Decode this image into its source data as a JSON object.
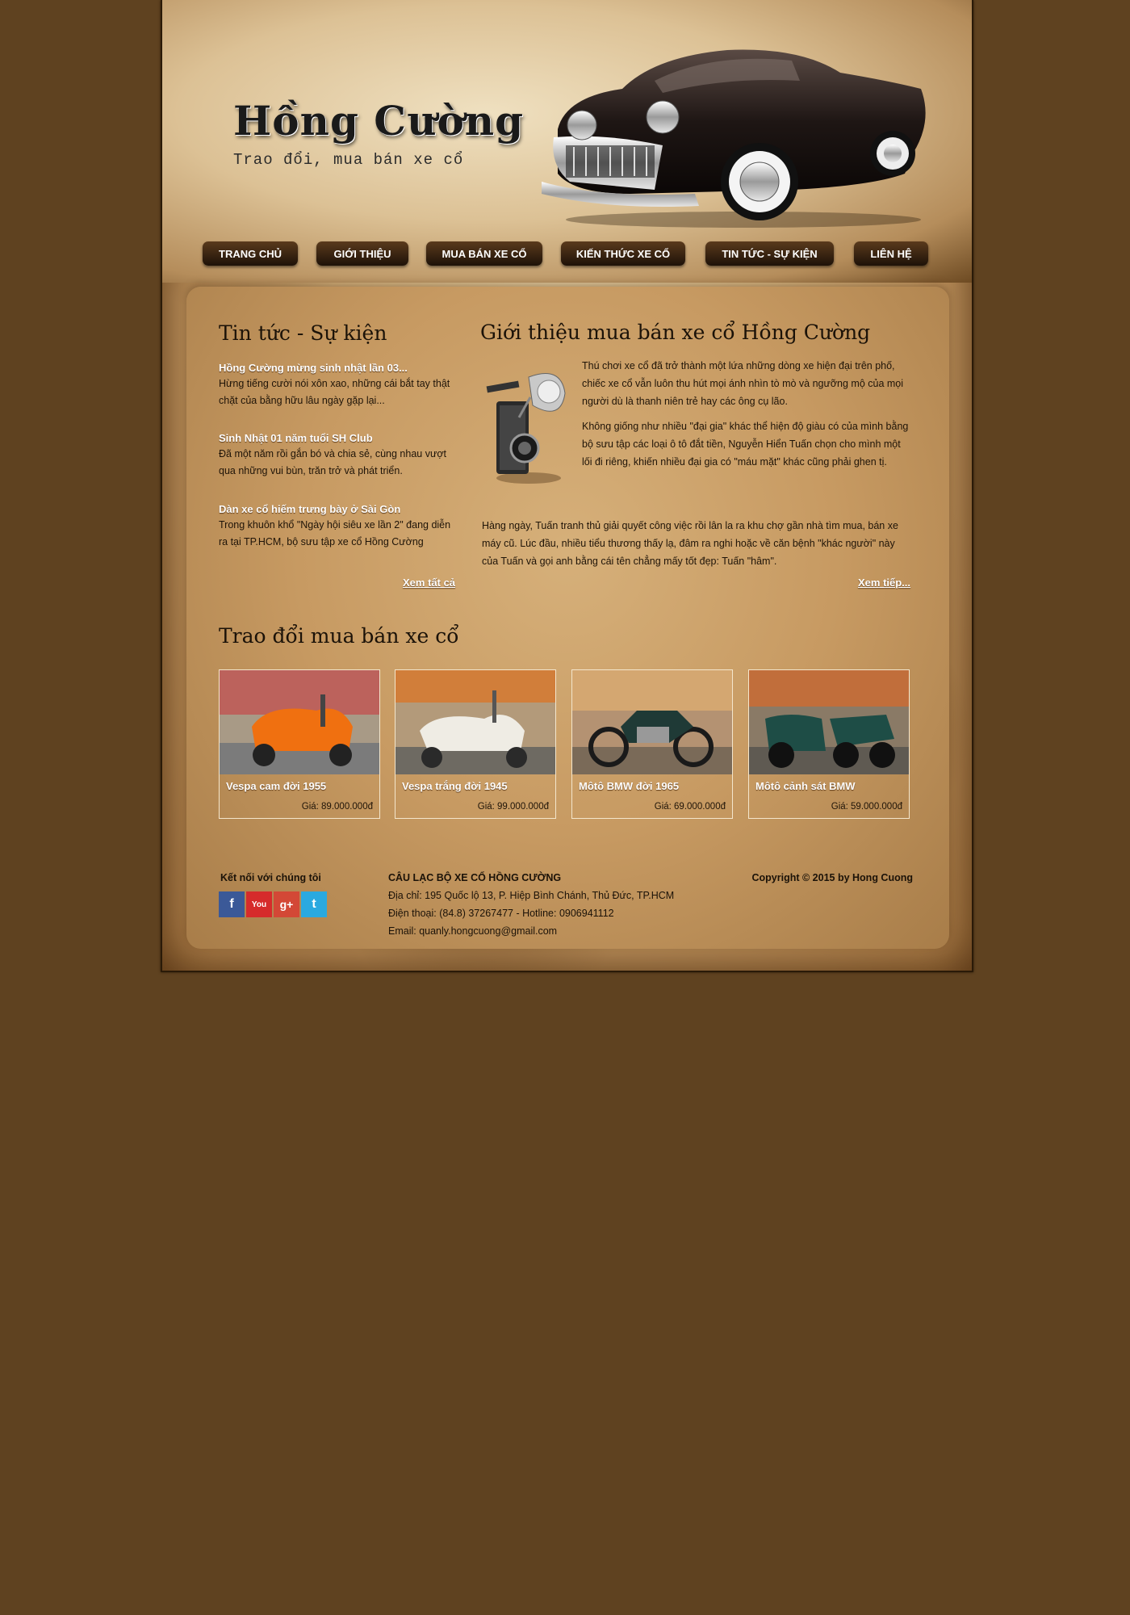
{
  "header": {
    "logo_title": "Hồng Cường",
    "logo_subtitle": "Trao đổi, mua bán xe cổ"
  },
  "nav": [
    {
      "label": "TRANG CHỦ"
    },
    {
      "label": "GIỚI THIỆU"
    },
    {
      "label": "MUA BÁN XE CỔ"
    },
    {
      "label": "KIẾN THỨC XE CỔ"
    },
    {
      "label": "TIN TỨC - SỰ KIỆN"
    },
    {
      "label": "LIÊN HỆ"
    }
  ],
  "news": {
    "title": "Tin tức - Sự kiện",
    "items": [
      {
        "title": "Hồng Cường mừng sinh nhật lần 03...",
        "desc": "Hừng tiếng cười nói xôn xao, những cái bắt tay thật chặt của bằng hữu lâu ngày gặp lại..."
      },
      {
        "title": "Sinh Nhật 01 năm tuổi SH Club",
        "desc": "Đã một năm rồi gắn bó và chia sẻ, cùng nhau vượt qua những vui bùn, trăn trở và phát triển."
      },
      {
        "title": "Dàn xe cổ hiếm trưng bày ở Sài Gòn",
        "desc": "Trong khuôn khổ \"Ngày hội siêu xe lần 2\" đang diễn ra tại TP.HCM, bộ sưu tập xe cổ Hồng Cường"
      }
    ],
    "more_label": "Xem tất cả"
  },
  "intro": {
    "title": "Giới thiệu mua bán xe cổ Hồng Cường",
    "p1": "Thú chơi xe cổ đã trở thành một lứa những dòng xe hiện đại trên phố, chiếc xe cổ vẫn luôn thu hút mọi ánh nhìn tò mò và ngưỡng mộ của mọi người dù là thanh niên trẻ hay các ông cụ lão.",
    "p2": "Không giống như nhiều \"đại gia\" khác thể hiện độ giàu có của mình bằng bộ sưu tập các loại ô tô đắt tiền, Nguyễn Hiển Tuấn chọn cho mình một lối đi riêng, khiến nhiều đại gia có \"máu mặt\" khác cũng phải ghen tị.",
    "p3": "Hàng ngày, Tuấn tranh thủ giải quyết công việc rồi lân la ra khu chợ gần nhà tìm mua, bán xe máy cũ. Lúc đầu, nhiều tiểu thương thấy lạ, đâm ra nghi hoặc về căn bệnh \"khác người\" này của Tuấn và gọi anh bằng cái tên chẳng mấy tốt đẹp: Tuấn \"hâm\".",
    "more_label": "Xem tiếp..."
  },
  "products": {
    "title": "Trao đổi mua bán xe cổ",
    "items": [
      {
        "name": "Vespa cam đời 1955",
        "price": "Giá: 89.000.000đ",
        "color": "#f06a10"
      },
      {
        "name": "Vespa trắng đời 1945",
        "price": "Giá: 99.000.000đ",
        "color": "#eeeae0"
      },
      {
        "name": "Môtô BMW đời 1965",
        "price": "Giá: 69.000.000đ",
        "color": "#1f3a36"
      },
      {
        "name": "Môtô cảnh sát BMW",
        "price": "Giá: 59.000.000đ",
        "color": "#1e4d46"
      }
    ]
  },
  "footer": {
    "connect_label": "Kết nối với chúng tôi",
    "social": [
      {
        "icon": "facebook-icon",
        "glyph": "f",
        "color": "#3b5998"
      },
      {
        "icon": "youtube-icon",
        "glyph": "You",
        "color": "#d62b2b"
      },
      {
        "icon": "googleplus-icon",
        "glyph": "g+",
        "color": "#d34836"
      },
      {
        "icon": "twitter-icon",
        "glyph": "t",
        "color": "#2aa9e0"
      }
    ],
    "club_name": "CÂU LẠC BỘ XE CỔ HỒNG CƯỜNG",
    "address": "Địa chỉ: 195 Quốc lộ 13, P. Hiệp Bình Chánh, Thủ Đức, TP.HCM",
    "phone": "Điện thoại: (84.8) 37267477 - Hotline: 0906941112",
    "email": "Email: quanly.hongcuong@gmail.com",
    "copyright": "Copyright © 2015 by Hong Cuong"
  }
}
